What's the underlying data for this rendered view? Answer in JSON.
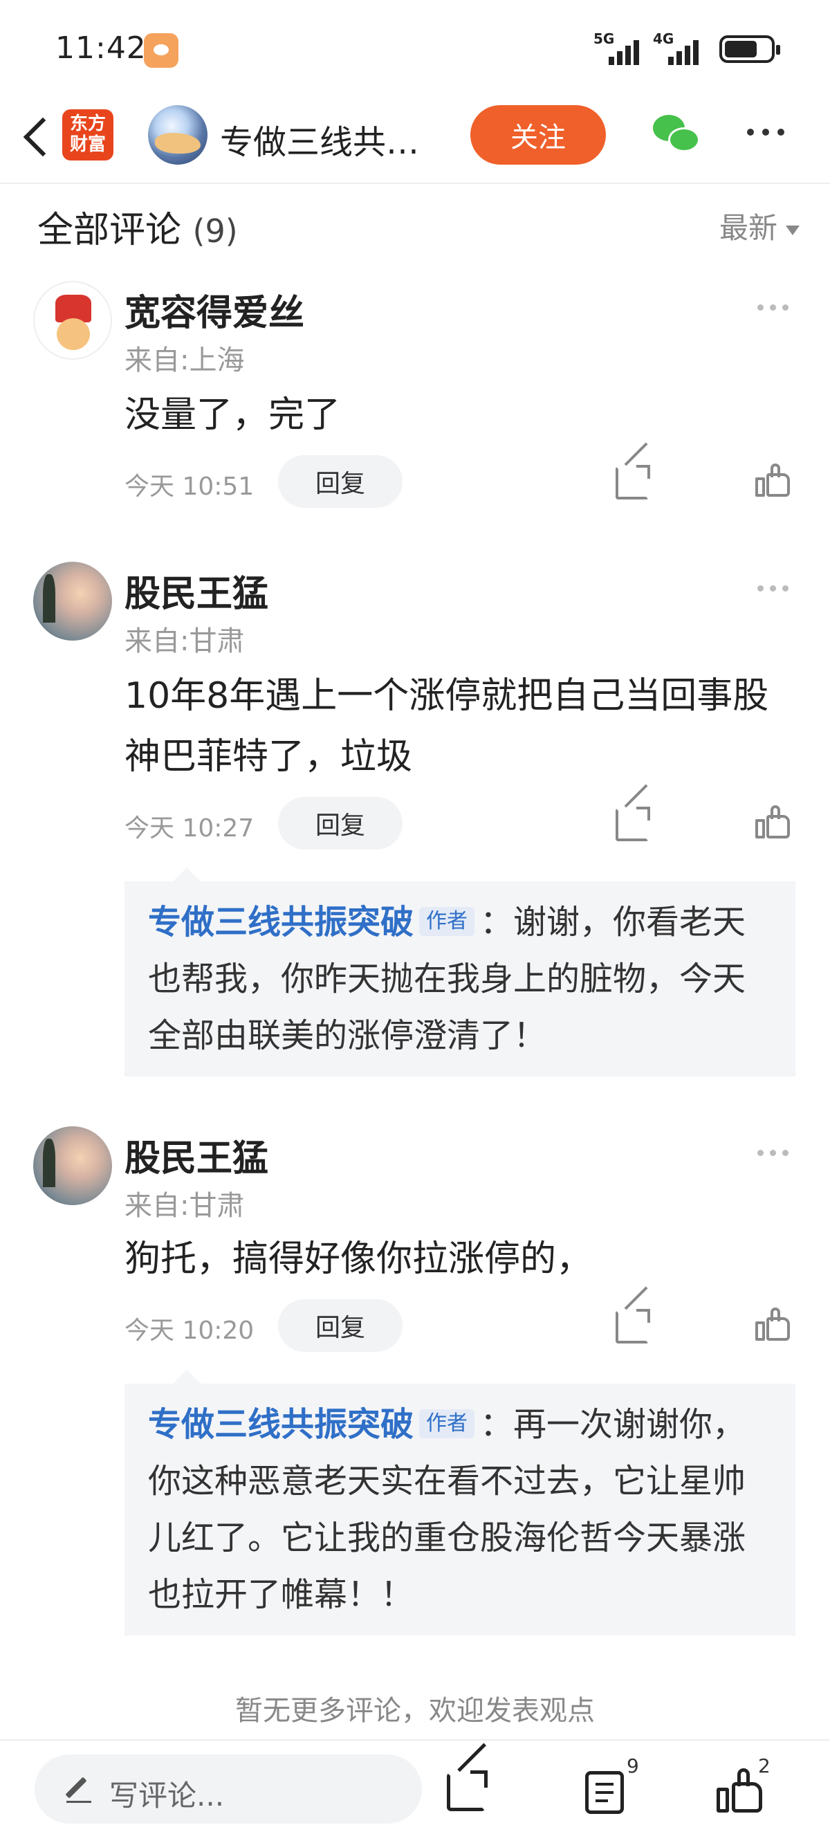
{
  "status_bar": {
    "time": "11:42",
    "net1": "5G",
    "net2": "4G"
  },
  "nav": {
    "app_logo": "东方财富",
    "title": "专做三线共…",
    "follow_label": "关注",
    "icons": [
      "back-icon",
      "wechat-icon",
      "more-icon"
    ]
  },
  "comments_header": {
    "title": "全部评论",
    "count": "(9)",
    "sort_label": "最新"
  },
  "comments": [
    {
      "name": "宽容得爱丝",
      "location": "来自:上海",
      "text": "没量了，完了",
      "time": "今天 10:51",
      "reply_label": "回复"
    },
    {
      "name": "股民王猛",
      "location": "来自:甘肃",
      "text": "10年8年遇上一个涨停就把自己当回事股神巴菲特了，垃圾",
      "time": "今天 10:27",
      "reply_label": "回复",
      "quote": {
        "author": "专做三线共振突破",
        "tag": "作者",
        "text": "：谢谢，你看老天也帮我，你昨天抛在我身上的脏物，今天全部由联美的涨停澄清了！"
      }
    },
    {
      "name": "股民王猛",
      "location": "来自:甘肃",
      "text": "狗托，搞得好像你拉涨停的，",
      "time": "今天 10:20",
      "reply_label": "回复",
      "quote": {
        "author": "专做三线共振突破",
        "tag": "作者",
        "text": "：再一次谢谢你，你这种恶意老天实在看不过去，它让星帅儿红了。它让我的重仓股海伦哲今天暴涨也拉开了帷幕！！"
      }
    }
  ],
  "end_text": "暂无更多评论，欢迎发表观点",
  "bottom_bar": {
    "write_placeholder": "写评论...",
    "comment_count": "9",
    "like_count": "2"
  },
  "colors": {
    "accent": "#f0602a",
    "author_blue": "#2f6fc7"
  }
}
